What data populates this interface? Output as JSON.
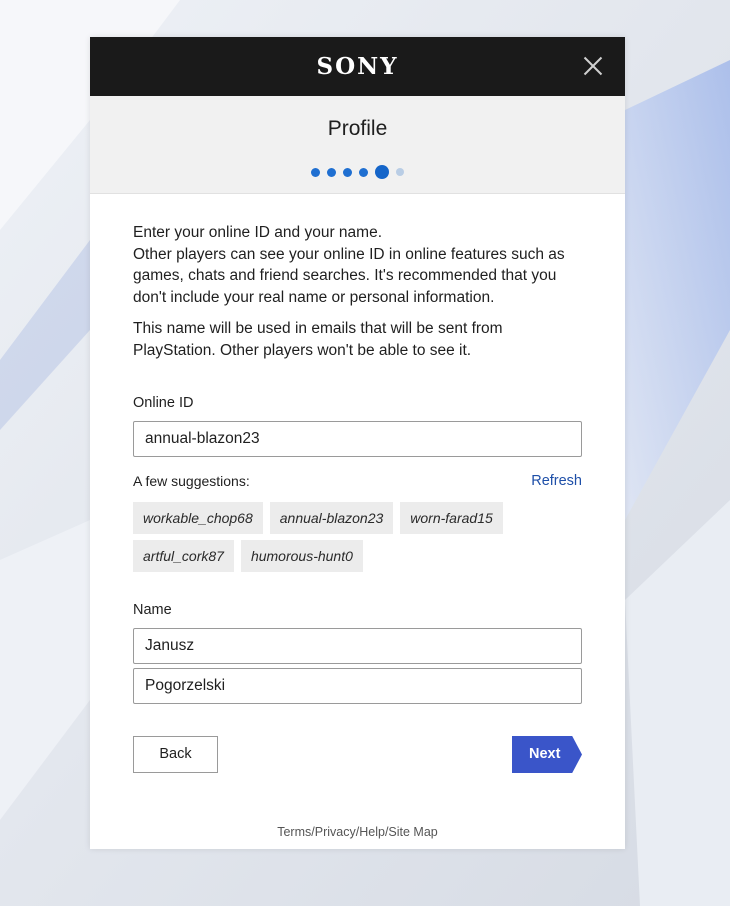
{
  "dialog": {
    "brand": "SONY",
    "title": "Profile",
    "progress": {
      "total_steps": 6,
      "current_step": 5
    },
    "intro_lines": [
      "Enter your online ID and your name.",
      "Other players can see your online ID in online features such as games, chats and friend searches. It's recommended that you don't include your real name or personal information."
    ],
    "name_note": "This name will be used in emails that will be sent from PlayStation. Other players won't be able to see it."
  },
  "online_id": {
    "label": "Online ID",
    "value": "annual-blazon23",
    "suggestions_label": "A few suggestions:",
    "refresh_label": "Refresh",
    "suggestions": [
      "workable_chop68",
      "annual-blazon23",
      "worn-farad15",
      "artful_cork87",
      "humorous-hunt0"
    ]
  },
  "name": {
    "label": "Name",
    "first_value": "Janusz",
    "last_value": "Pogorzelski"
  },
  "buttons": {
    "back_label": "Back",
    "next_label": "Next"
  },
  "footer": {
    "terms": "Terms",
    "privacy": "Privacy",
    "help": "Help",
    "site_map": "Site Map",
    "separator": "/"
  },
  "colors": {
    "topbar": "#1a1a1a",
    "accent_blue": "#3a55c9",
    "link_blue": "#1e4fa8",
    "progress_dot": "#1f6fd1"
  }
}
